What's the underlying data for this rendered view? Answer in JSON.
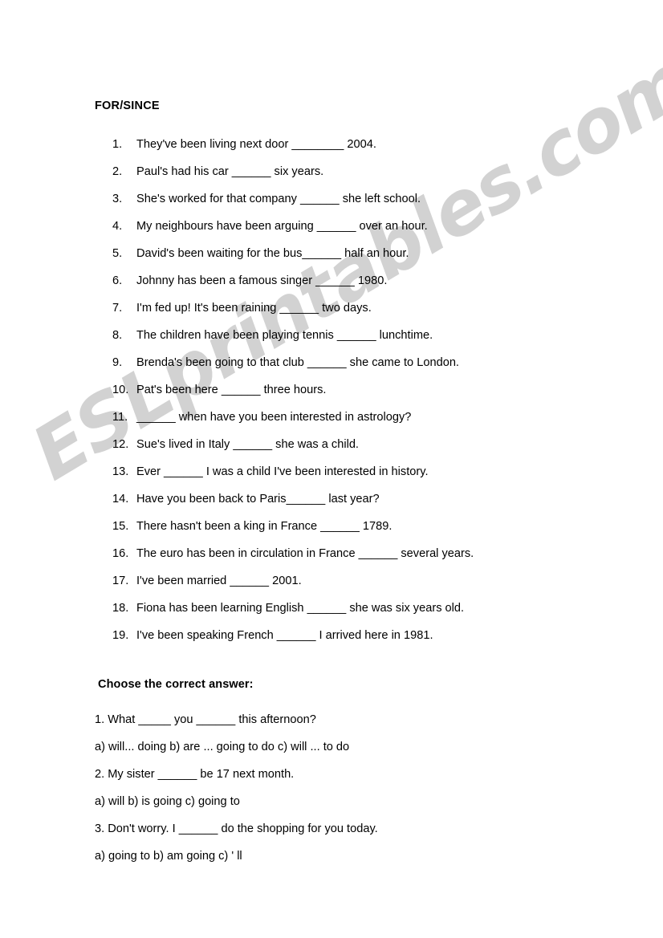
{
  "document": {
    "title": "FOR/SINCE",
    "watermark": "ESLprintables.com",
    "watermark_color": "#d2d2d2",
    "background_color": "#ffffff",
    "text_color": "#000000"
  },
  "fill_in_exercise": {
    "heading": "FOR/SINCE",
    "items": [
      {
        "number": "1.",
        "text": "They've been living next door ________ 2004."
      },
      {
        "number": "2.",
        "text": "Paul's had his car ______ six years."
      },
      {
        "number": "3.",
        "text": "She's worked for that company ______  she left school."
      },
      {
        "number": "4.",
        "text": "My neighbours have been arguing ______  over an hour."
      },
      {
        "number": "5.",
        "text": "David's been waiting for the bus______ half an hour."
      },
      {
        "number": "6.",
        "text": "Johnny has been a famous singer ______  1980."
      },
      {
        "number": "7.",
        "text": "I'm fed up!  It's been raining ______  two days."
      },
      {
        "number": "8.",
        "text": "The children have been playing tennis ______  lunchtime."
      },
      {
        "number": "9.",
        "text": "Brenda's been going to that club ______  she came to London."
      },
      {
        "number": "10.",
        "text": "Pat's been here ______  three hours."
      },
      {
        "number": "11.",
        "text": "______  when have you been interested in astrology?"
      },
      {
        "number": "12.",
        "text": "Sue's lived in Italy ______   she was a child."
      },
      {
        "number": "13.",
        "text": "Ever ______  I was a child I've been interested in history."
      },
      {
        "number": "14.",
        "text": "Have you been back to Paris______  last year?"
      },
      {
        "number": "15.",
        "text": "There hasn't been a king in France ______  1789."
      },
      {
        "number": "16.",
        "text": "The euro has been in circulation in France ______  several years."
      },
      {
        "number": "17.",
        "text": "I've been married ______  2001."
      },
      {
        "number": "18.",
        "text": "Fiona has been learning English ______   she was six years old."
      },
      {
        "number": "19.",
        "text": "I've been speaking French ______   I arrived here in 1981."
      }
    ]
  },
  "multiple_choice_exercise": {
    "heading": "Choose the correct answer:",
    "questions": [
      {
        "prompt": "1. What _____ you ______ this afternoon?",
        "options": "a) will... doing   b) are ...  going to do   c) will ...  to do"
      },
      {
        "prompt": "2. My sister ______ be 17 next month.",
        "options": "a) will   b) is going   c) going to"
      },
      {
        "prompt": "3. Don't worry. I ______ do the shopping for you today.",
        "options": "a) going to   b) am going   c) ' ll"
      }
    ]
  }
}
